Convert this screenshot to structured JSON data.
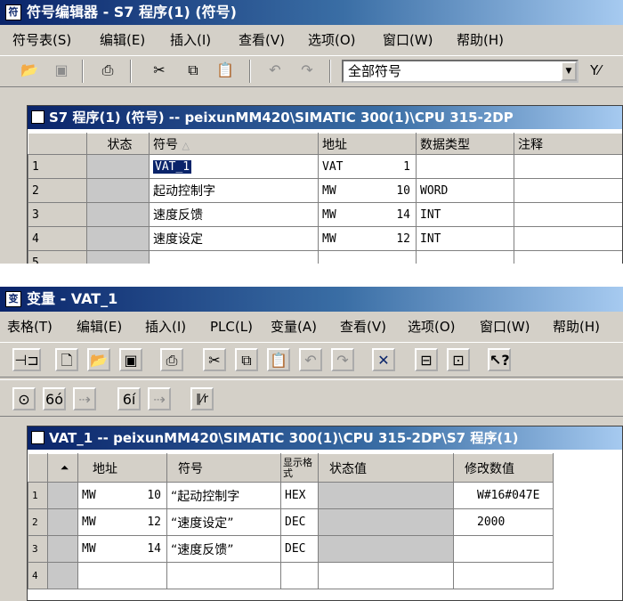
{
  "win1": {
    "title": "符号编辑器 - S7 程序(1) (符号)",
    "menu": [
      "符号表(S)",
      "编辑(E)",
      "插入(I)",
      "查看(V)",
      "选项(O)",
      "窗口(W)",
      "帮助(H)"
    ],
    "filter": "全部符号",
    "sub_title": "S7 程序(1) (符号) -- peixunMM420\\SIMATIC 300(1)\\CPU 315-2DP",
    "columns": [
      "状态",
      "符号",
      "地址",
      "数据类型",
      "注释"
    ],
    "rows": [
      {
        "n": "1",
        "symbol": "VAT_1",
        "addr": "VAT",
        "addr_num": "1",
        "type": ""
      },
      {
        "n": "2",
        "symbol": "起动控制字",
        "addr": "MW",
        "addr_num": "10",
        "type": "WORD"
      },
      {
        "n": "3",
        "symbol": "速度反馈",
        "addr": "MW",
        "addr_num": "14",
        "type": "INT"
      },
      {
        "n": "4",
        "symbol": "速度设定",
        "addr": "MW",
        "addr_num": "12",
        "type": "INT"
      },
      {
        "n": "5",
        "symbol": "",
        "addr": "",
        "addr_num": "",
        "type": ""
      }
    ]
  },
  "win2": {
    "title": "变量 - VAT_1",
    "menu": [
      "表格(T)",
      "编辑(E)",
      "插入(I)",
      "PLC(L)",
      "变量(A)",
      "查看(V)",
      "选项(O)",
      "窗口(W)",
      "帮助(H)"
    ],
    "sub_title": "VAT_1 -- peixunMM420\\SIMATIC 300(1)\\CPU 315-2DP\\S7 程序(1)",
    "columns": [
      "地址",
      "符号",
      "显示格式",
      "状态值",
      "修改数值"
    ],
    "rows": [
      {
        "n": "1",
        "addr": "MW",
        "addr_num": "10",
        "symbol": "“起动控制字",
        "fmt": "HEX",
        "status": "",
        "modify": "W#16#047E"
      },
      {
        "n": "2",
        "addr": "MW",
        "addr_num": "12",
        "symbol": "“速度设定”",
        "fmt": "DEC",
        "status": "",
        "modify": "2000"
      },
      {
        "n": "3",
        "addr": "MW",
        "addr_num": "14",
        "symbol": "“速度反馈”",
        "fmt": "DEC",
        "status": "",
        "modify": ""
      },
      {
        "n": "4",
        "addr": "",
        "addr_num": "",
        "symbol": "",
        "fmt": "",
        "status": "",
        "modify": ""
      }
    ]
  }
}
